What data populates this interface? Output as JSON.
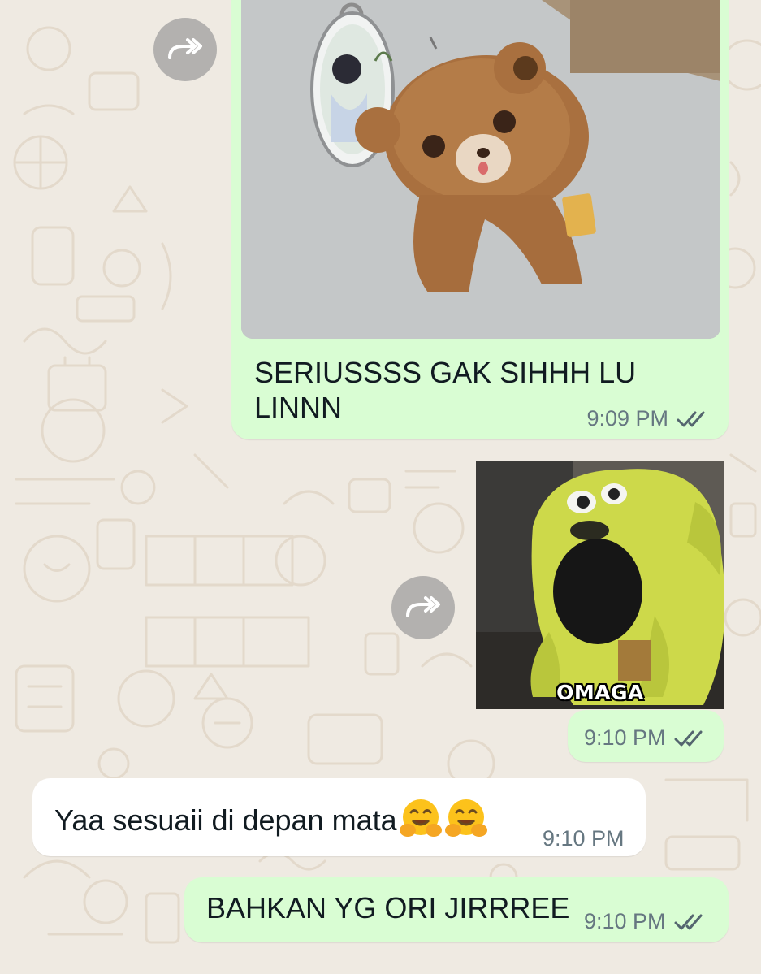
{
  "chat": {
    "messages": [
      {
        "id": "m1",
        "direction": "outgoing",
        "type": "image",
        "image": "photo of a brown teddy bear keychain next to an acrylic character charm",
        "forwardable": true,
        "text": "SERIUSSSS GAK SIHHH LU LINNN",
        "time": "9:09 PM",
        "status": "read"
      },
      {
        "id": "m2",
        "direction": "outgoing",
        "type": "sticker",
        "image": "yellow cartoon character shouting sticker",
        "forwardable": true,
        "sticker_caption": "OMAGA",
        "time": "9:10 PM",
        "status": "read"
      },
      {
        "id": "m3",
        "direction": "incoming",
        "type": "text",
        "text": "Yaa sesuaii di depan mata",
        "emojis": [
          "hugging-face-emoji",
          "hugging-face-emoji"
        ],
        "time": "9:10 PM"
      },
      {
        "id": "m4",
        "direction": "outgoing",
        "type": "text",
        "text": "BAHKAN YG ORI JIRRREE",
        "time": "9:10 PM",
        "status": "read"
      }
    ]
  },
  "colors": {
    "wallpaper": "#efeae2",
    "outgoing_bubble": "#d9fdd3",
    "incoming_bubble": "#ffffff",
    "meta_text": "#667781",
    "read_ticks": "#54656f"
  },
  "icons": {
    "forward": "forward-icon",
    "ticks": "double-check-icon"
  }
}
